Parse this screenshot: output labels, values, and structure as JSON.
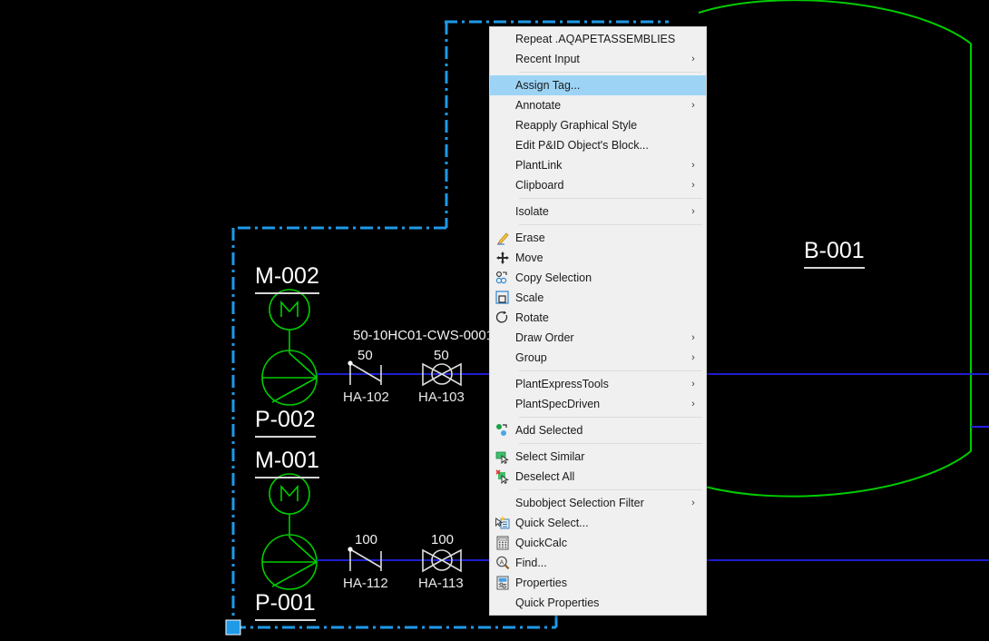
{
  "app": {
    "background_color": "#000000",
    "drawing_color_equipment": "#00cc00",
    "drawing_color_pipe": "#2222ee",
    "drawing_color_selection": "#1e9ae8",
    "drawing_color_text": "#ffffff"
  },
  "drawing": {
    "equipment": [
      {
        "name": "motor-top",
        "tag": "M-002",
        "type": "motor"
      },
      {
        "name": "pump-top",
        "tag": "P-002",
        "type": "centrifugal-pump"
      },
      {
        "name": "motor-bottom",
        "tag": "M-001",
        "type": "motor"
      },
      {
        "name": "pump-bottom",
        "tag": "P-001",
        "type": "centrifugal-pump"
      },
      {
        "name": "vessel",
        "tag": "B-001",
        "type": "vessel"
      }
    ],
    "line_number": "50-10HC01-CWS-0001",
    "top_branch": {
      "sizes": [
        "50",
        "50"
      ],
      "valves": [
        {
          "tag": "HA-102",
          "type": "check-valve"
        },
        {
          "tag": "HA-103",
          "type": "gate-valve"
        }
      ]
    },
    "bottom_branch": {
      "sizes": [
        "100",
        "100"
      ],
      "valves": [
        {
          "tag": "HA-112",
          "type": "check-valve"
        },
        {
          "tag": "HA-113",
          "type": "gate-valve"
        }
      ]
    },
    "motor_glyph": "M",
    "selection_grip_color": "#1e9ae8"
  },
  "context_menu": {
    "items": [
      {
        "label": "Repeat .AQAPETASSEMBLIES",
        "icon": "",
        "arrow": false,
        "selected": false,
        "separator_after": false
      },
      {
        "label": "Recent Input",
        "icon": "",
        "arrow": true,
        "selected": false,
        "separator_after": true
      },
      {
        "label": "Assign Tag...",
        "icon": "",
        "arrow": false,
        "selected": true,
        "separator_after": false
      },
      {
        "label": "Annotate",
        "icon": "",
        "arrow": true,
        "selected": false,
        "separator_after": false
      },
      {
        "label": "Reapply Graphical Style",
        "icon": "",
        "arrow": false,
        "selected": false,
        "separator_after": false
      },
      {
        "label": "Edit P&ID Object's Block...",
        "icon": "",
        "arrow": false,
        "selected": false,
        "separator_after": false
      },
      {
        "label": "PlantLink",
        "icon": "",
        "arrow": true,
        "selected": false,
        "separator_after": false
      },
      {
        "label": "Clipboard",
        "icon": "",
        "arrow": true,
        "selected": false,
        "separator_after": true
      },
      {
        "label": "Isolate",
        "icon": "",
        "arrow": true,
        "selected": false,
        "separator_after": true
      },
      {
        "label": "Erase",
        "icon": "eraser-icon",
        "arrow": false,
        "selected": false,
        "separator_after": false
      },
      {
        "label": "Move",
        "icon": "move-icon",
        "arrow": false,
        "selected": false,
        "separator_after": false
      },
      {
        "label": "Copy Selection",
        "icon": "copy-icon",
        "arrow": false,
        "selected": false,
        "separator_after": false
      },
      {
        "label": "Scale",
        "icon": "scale-icon",
        "arrow": false,
        "selected": false,
        "separator_after": false
      },
      {
        "label": "Rotate",
        "icon": "rotate-icon",
        "arrow": false,
        "selected": false,
        "separator_after": false
      },
      {
        "label": "Draw Order",
        "icon": "",
        "arrow": true,
        "selected": false,
        "separator_after": false
      },
      {
        "label": "Group",
        "icon": "",
        "arrow": true,
        "selected": false,
        "separator_after": true
      },
      {
        "label": "PlantExpressTools",
        "icon": "",
        "arrow": true,
        "selected": false,
        "separator_after": false
      },
      {
        "label": "PlantSpecDriven",
        "icon": "",
        "arrow": true,
        "selected": false,
        "separator_after": true
      },
      {
        "label": "Add Selected",
        "icon": "add-selected-icon",
        "arrow": false,
        "selected": false,
        "separator_after": true
      },
      {
        "label": "Select Similar",
        "icon": "select-similar-icon",
        "arrow": false,
        "selected": false,
        "separator_after": false
      },
      {
        "label": "Deselect All",
        "icon": "deselect-all-icon",
        "arrow": false,
        "selected": false,
        "separator_after": true
      },
      {
        "label": "Subobject Selection Filter",
        "icon": "",
        "arrow": true,
        "selected": false,
        "separator_after": false
      },
      {
        "label": "Quick Select...",
        "icon": "quick-select-icon",
        "arrow": false,
        "selected": false,
        "separator_after": false
      },
      {
        "label": "QuickCalc",
        "icon": "quickcalc-icon",
        "arrow": false,
        "selected": false,
        "separator_after": false
      },
      {
        "label": "Find...",
        "icon": "find-icon",
        "arrow": false,
        "selected": false,
        "separator_after": false
      },
      {
        "label": "Properties",
        "icon": "properties-icon",
        "arrow": false,
        "selected": false,
        "separator_after": false
      },
      {
        "label": "Quick Properties",
        "icon": "",
        "arrow": false,
        "selected": false,
        "separator_after": false
      }
    ],
    "submenu_arrow_glyph": "›"
  }
}
